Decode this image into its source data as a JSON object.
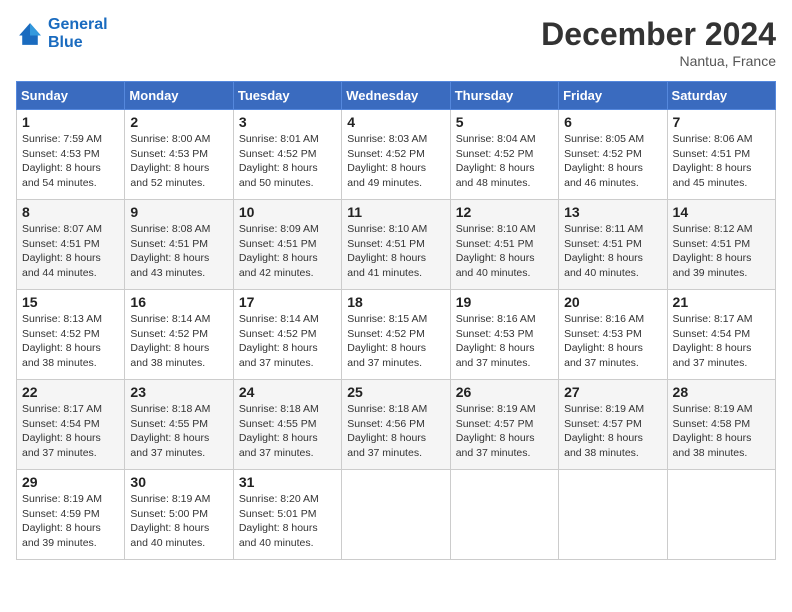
{
  "header": {
    "logo_line1": "General",
    "logo_line2": "Blue",
    "month": "December 2024",
    "location": "Nantua, France"
  },
  "days_of_week": [
    "Sunday",
    "Monday",
    "Tuesday",
    "Wednesday",
    "Thursday",
    "Friday",
    "Saturday"
  ],
  "weeks": [
    [
      {
        "day": "1",
        "sunrise": "7:59 AM",
        "sunset": "4:53 PM",
        "daylight": "8 hours and 54 minutes."
      },
      {
        "day": "2",
        "sunrise": "8:00 AM",
        "sunset": "4:53 PM",
        "daylight": "8 hours and 52 minutes."
      },
      {
        "day": "3",
        "sunrise": "8:01 AM",
        "sunset": "4:52 PM",
        "daylight": "8 hours and 50 minutes."
      },
      {
        "day": "4",
        "sunrise": "8:03 AM",
        "sunset": "4:52 PM",
        "daylight": "8 hours and 49 minutes."
      },
      {
        "day": "5",
        "sunrise": "8:04 AM",
        "sunset": "4:52 PM",
        "daylight": "8 hours and 48 minutes."
      },
      {
        "day": "6",
        "sunrise": "8:05 AM",
        "sunset": "4:52 PM",
        "daylight": "8 hours and 46 minutes."
      },
      {
        "day": "7",
        "sunrise": "8:06 AM",
        "sunset": "4:51 PM",
        "daylight": "8 hours and 45 minutes."
      }
    ],
    [
      {
        "day": "8",
        "sunrise": "8:07 AM",
        "sunset": "4:51 PM",
        "daylight": "8 hours and 44 minutes."
      },
      {
        "day": "9",
        "sunrise": "8:08 AM",
        "sunset": "4:51 PM",
        "daylight": "8 hours and 43 minutes."
      },
      {
        "day": "10",
        "sunrise": "8:09 AM",
        "sunset": "4:51 PM",
        "daylight": "8 hours and 42 minutes."
      },
      {
        "day": "11",
        "sunrise": "8:10 AM",
        "sunset": "4:51 PM",
        "daylight": "8 hours and 41 minutes."
      },
      {
        "day": "12",
        "sunrise": "8:10 AM",
        "sunset": "4:51 PM",
        "daylight": "8 hours and 40 minutes."
      },
      {
        "day": "13",
        "sunrise": "8:11 AM",
        "sunset": "4:51 PM",
        "daylight": "8 hours and 40 minutes."
      },
      {
        "day": "14",
        "sunrise": "8:12 AM",
        "sunset": "4:51 PM",
        "daylight": "8 hours and 39 minutes."
      }
    ],
    [
      {
        "day": "15",
        "sunrise": "8:13 AM",
        "sunset": "4:52 PM",
        "daylight": "8 hours and 38 minutes."
      },
      {
        "day": "16",
        "sunrise": "8:14 AM",
        "sunset": "4:52 PM",
        "daylight": "8 hours and 38 minutes."
      },
      {
        "day": "17",
        "sunrise": "8:14 AM",
        "sunset": "4:52 PM",
        "daylight": "8 hours and 37 minutes."
      },
      {
        "day": "18",
        "sunrise": "8:15 AM",
        "sunset": "4:52 PM",
        "daylight": "8 hours and 37 minutes."
      },
      {
        "day": "19",
        "sunrise": "8:16 AM",
        "sunset": "4:53 PM",
        "daylight": "8 hours and 37 minutes."
      },
      {
        "day": "20",
        "sunrise": "8:16 AM",
        "sunset": "4:53 PM",
        "daylight": "8 hours and 37 minutes."
      },
      {
        "day": "21",
        "sunrise": "8:17 AM",
        "sunset": "4:54 PM",
        "daylight": "8 hours and 37 minutes."
      }
    ],
    [
      {
        "day": "22",
        "sunrise": "8:17 AM",
        "sunset": "4:54 PM",
        "daylight": "8 hours and 37 minutes."
      },
      {
        "day": "23",
        "sunrise": "8:18 AM",
        "sunset": "4:55 PM",
        "daylight": "8 hours and 37 minutes."
      },
      {
        "day": "24",
        "sunrise": "8:18 AM",
        "sunset": "4:55 PM",
        "daylight": "8 hours and 37 minutes."
      },
      {
        "day": "25",
        "sunrise": "8:18 AM",
        "sunset": "4:56 PM",
        "daylight": "8 hours and 37 minutes."
      },
      {
        "day": "26",
        "sunrise": "8:19 AM",
        "sunset": "4:57 PM",
        "daylight": "8 hours and 37 minutes."
      },
      {
        "day": "27",
        "sunrise": "8:19 AM",
        "sunset": "4:57 PM",
        "daylight": "8 hours and 38 minutes."
      },
      {
        "day": "28",
        "sunrise": "8:19 AM",
        "sunset": "4:58 PM",
        "daylight": "8 hours and 38 minutes."
      }
    ],
    [
      {
        "day": "29",
        "sunrise": "8:19 AM",
        "sunset": "4:59 PM",
        "daylight": "8 hours and 39 minutes."
      },
      {
        "day": "30",
        "sunrise": "8:19 AM",
        "sunset": "5:00 PM",
        "daylight": "8 hours and 40 minutes."
      },
      {
        "day": "31",
        "sunrise": "8:20 AM",
        "sunset": "5:01 PM",
        "daylight": "8 hours and 40 minutes."
      },
      null,
      null,
      null,
      null
    ]
  ]
}
